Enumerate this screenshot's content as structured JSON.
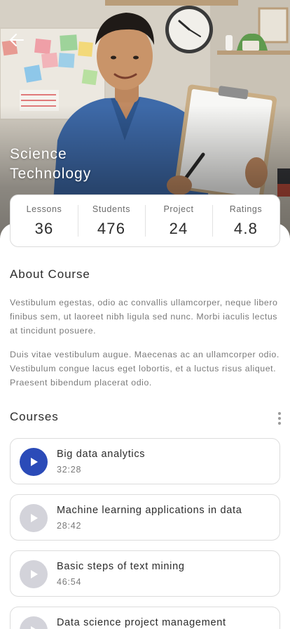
{
  "hero": {
    "title_line1": "Science",
    "title_line2": "Technology"
  },
  "stats": [
    {
      "label": "Lessons",
      "value": "36"
    },
    {
      "label": "Students",
      "value": "476"
    },
    {
      "label": "Project",
      "value": "24"
    },
    {
      "label": "Ratings",
      "value": "4.8"
    }
  ],
  "about": {
    "heading": "About Course",
    "paragraph1": "Vestibulum egestas, odio ac convallis ullamcorper, neque libero finibus sem, ut laoreet nibh ligula sed nunc. Morbi iaculis lectus at tincidunt posuere.",
    "paragraph2": "Duis vitae vestibulum augue. Maecenas ac an ullamcorper odio. Vestibulum congue lacus eget lobortis, et a luctus risus aliquet. Praesent bibendum placerat odio."
  },
  "courses": {
    "heading": "Courses",
    "items": [
      {
        "title": "Big data analytics",
        "duration": "32:28",
        "state": "playing"
      },
      {
        "title": "Machine learning applications in data",
        "duration": "28:42",
        "state": "idle"
      },
      {
        "title": "Basic steps of text mining",
        "duration": "46:54",
        "state": "idle"
      },
      {
        "title": "Data science project management",
        "duration": "",
        "state": "idle"
      }
    ]
  },
  "colors": {
    "accent": "#2b4bb8",
    "inactive_play": "#d3d3da",
    "card_border": "#dcdcdc"
  },
  "icons": {
    "back": "arrow-left-icon",
    "more": "more-vertical-icon",
    "play": "play-icon"
  }
}
